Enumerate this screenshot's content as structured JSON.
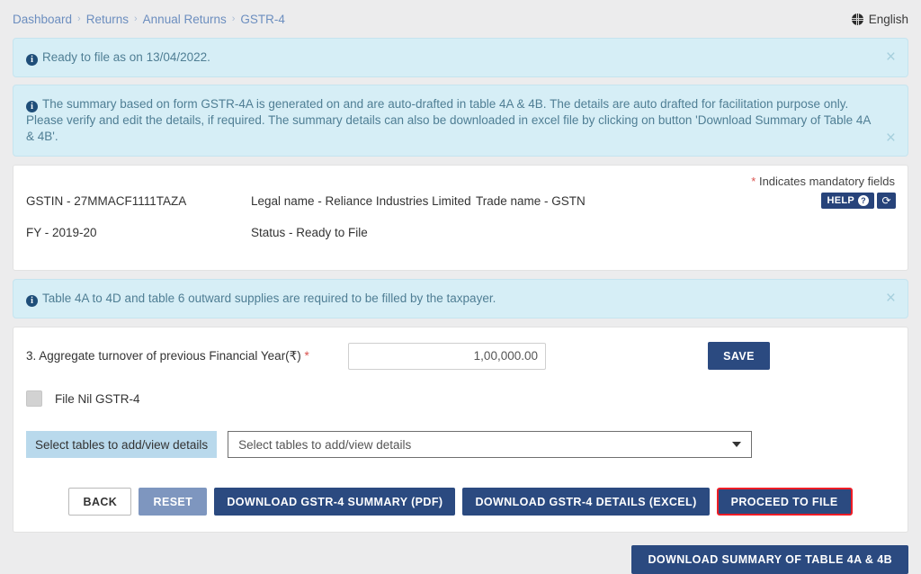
{
  "breadcrumb": {
    "items": [
      {
        "label": "Dashboard"
      },
      {
        "label": "Returns"
      },
      {
        "label": "Annual Returns"
      },
      {
        "label": "GSTR-4"
      }
    ],
    "separator": "›"
  },
  "language": {
    "icon": "globe-icon",
    "label": "English"
  },
  "alerts": [
    {
      "id": "ready-to-file",
      "text": "Ready to file as on 13/04/2022.",
      "close_label": "×"
    },
    {
      "id": "auto-draft-summary",
      "text": "The summary based on form GSTR-4A is generated on and are auto-drafted in table 4A & 4B. The details are auto drafted for facilitation purpose only. Please verify and edit the details, if required. The summary details can also be downloaded in excel file by clicking on button 'Download Summary of Table 4A & 4B'.",
      "close_label": "×"
    },
    {
      "id": "tables-required",
      "text": "Table 4A to 4D and table 6 outward supplies are required to be filled by the taxpayer.",
      "close_label": "×"
    }
  ],
  "taxpayer": {
    "mandatory_note_star": "*",
    "mandatory_note": "Indicates mandatory fields",
    "gstin": "GSTIN - 27MMACF1111TAZA",
    "legal_name": "Legal name - Reliance Industries Limited",
    "trade_name": "Trade name - GSTN",
    "fy": "FY - 2019-20",
    "status": "Status - Ready to File",
    "help_label": "HELP",
    "help_icon_glyph": "?",
    "refresh_icon_glyph": "⟳"
  },
  "form": {
    "turnover_label": "3. Aggregate turnover of previous Financial Year(₹)",
    "turnover_star": "*",
    "turnover_value": "1,00,000.00",
    "turnover_placeholder": "Enter amount",
    "save_label": "SAVE",
    "nil_checkbox_label": "File Nil GSTR-4",
    "select_tag_label": "Select tables to add/view details",
    "select_value": "Select tables to add/view details"
  },
  "actions": {
    "back": "BACK",
    "reset": "RESET",
    "download_pdf": "DOWNLOAD GSTR-4 SUMMARY (PDF)",
    "download_excel": "DOWNLOAD GSTR-4 DETAILS (EXCEL)",
    "proceed": "PROCEED TO FILE",
    "download_summary_4a4b": "DOWNLOAD SUMMARY OF TABLE 4A & 4B"
  },
  "colors": {
    "primary": "#2b4a80",
    "help_navy": "#27437a",
    "alert_bg": "#d6eef6",
    "alert_text": "#4f7e94",
    "tag_blue": "#b9d9ec",
    "highlight_red": "#ee1c25",
    "mandatory_red": "#d9534f",
    "page_bg": "#ececed"
  }
}
